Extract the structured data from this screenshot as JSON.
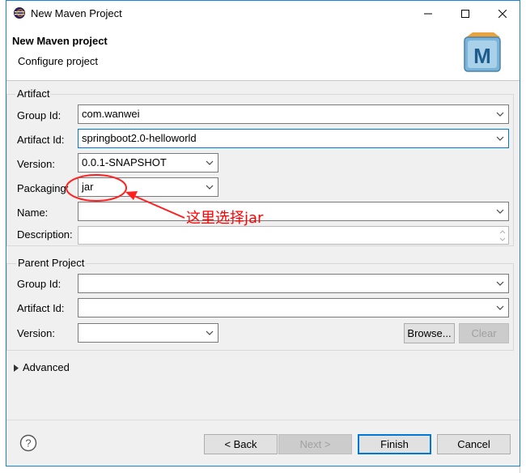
{
  "window": {
    "title": "New Maven Project"
  },
  "header": {
    "title": "New Maven project",
    "subtitle": "Configure project"
  },
  "artifact": {
    "group_label": "Artifact",
    "group_id": {
      "label": "Group Id:",
      "value": "com.wanwei"
    },
    "artifact_id": {
      "label": "Artifact Id:",
      "value": "springboot2.0-helloworld"
    },
    "version": {
      "label": "Version:",
      "value": "0.0.1-SNAPSHOT"
    },
    "packaging": {
      "label": "Packaging:",
      "value": "jar"
    },
    "name": {
      "label": "Name:",
      "value": ""
    },
    "description": {
      "label": "Description:",
      "value": ""
    }
  },
  "parent": {
    "group_label": "Parent Project",
    "group_id": {
      "label": "Group Id:",
      "value": ""
    },
    "artifact_id": {
      "label": "Artifact Id:",
      "value": ""
    },
    "version": {
      "label": "Version:",
      "value": ""
    },
    "browse_label": "Browse...",
    "clear_label": "Clear"
  },
  "advanced": {
    "label": "Advanced"
  },
  "footer": {
    "back_label": "< Back",
    "next_label": "Next >",
    "finish_label": "Finish",
    "cancel_label": "Cancel"
  },
  "annotation": {
    "text": "这里选择jar",
    "color": "#ff0000"
  },
  "colors": {
    "accent": "#0078d7",
    "window_border": "#1883d7",
    "annotation": "#ff0000"
  },
  "icons": [
    "eclipse-icon",
    "minimize-icon",
    "maximize-icon",
    "close-icon",
    "maven-logo-icon",
    "chevron-down-icon",
    "expand-arrow-icon",
    "help-icon"
  ]
}
